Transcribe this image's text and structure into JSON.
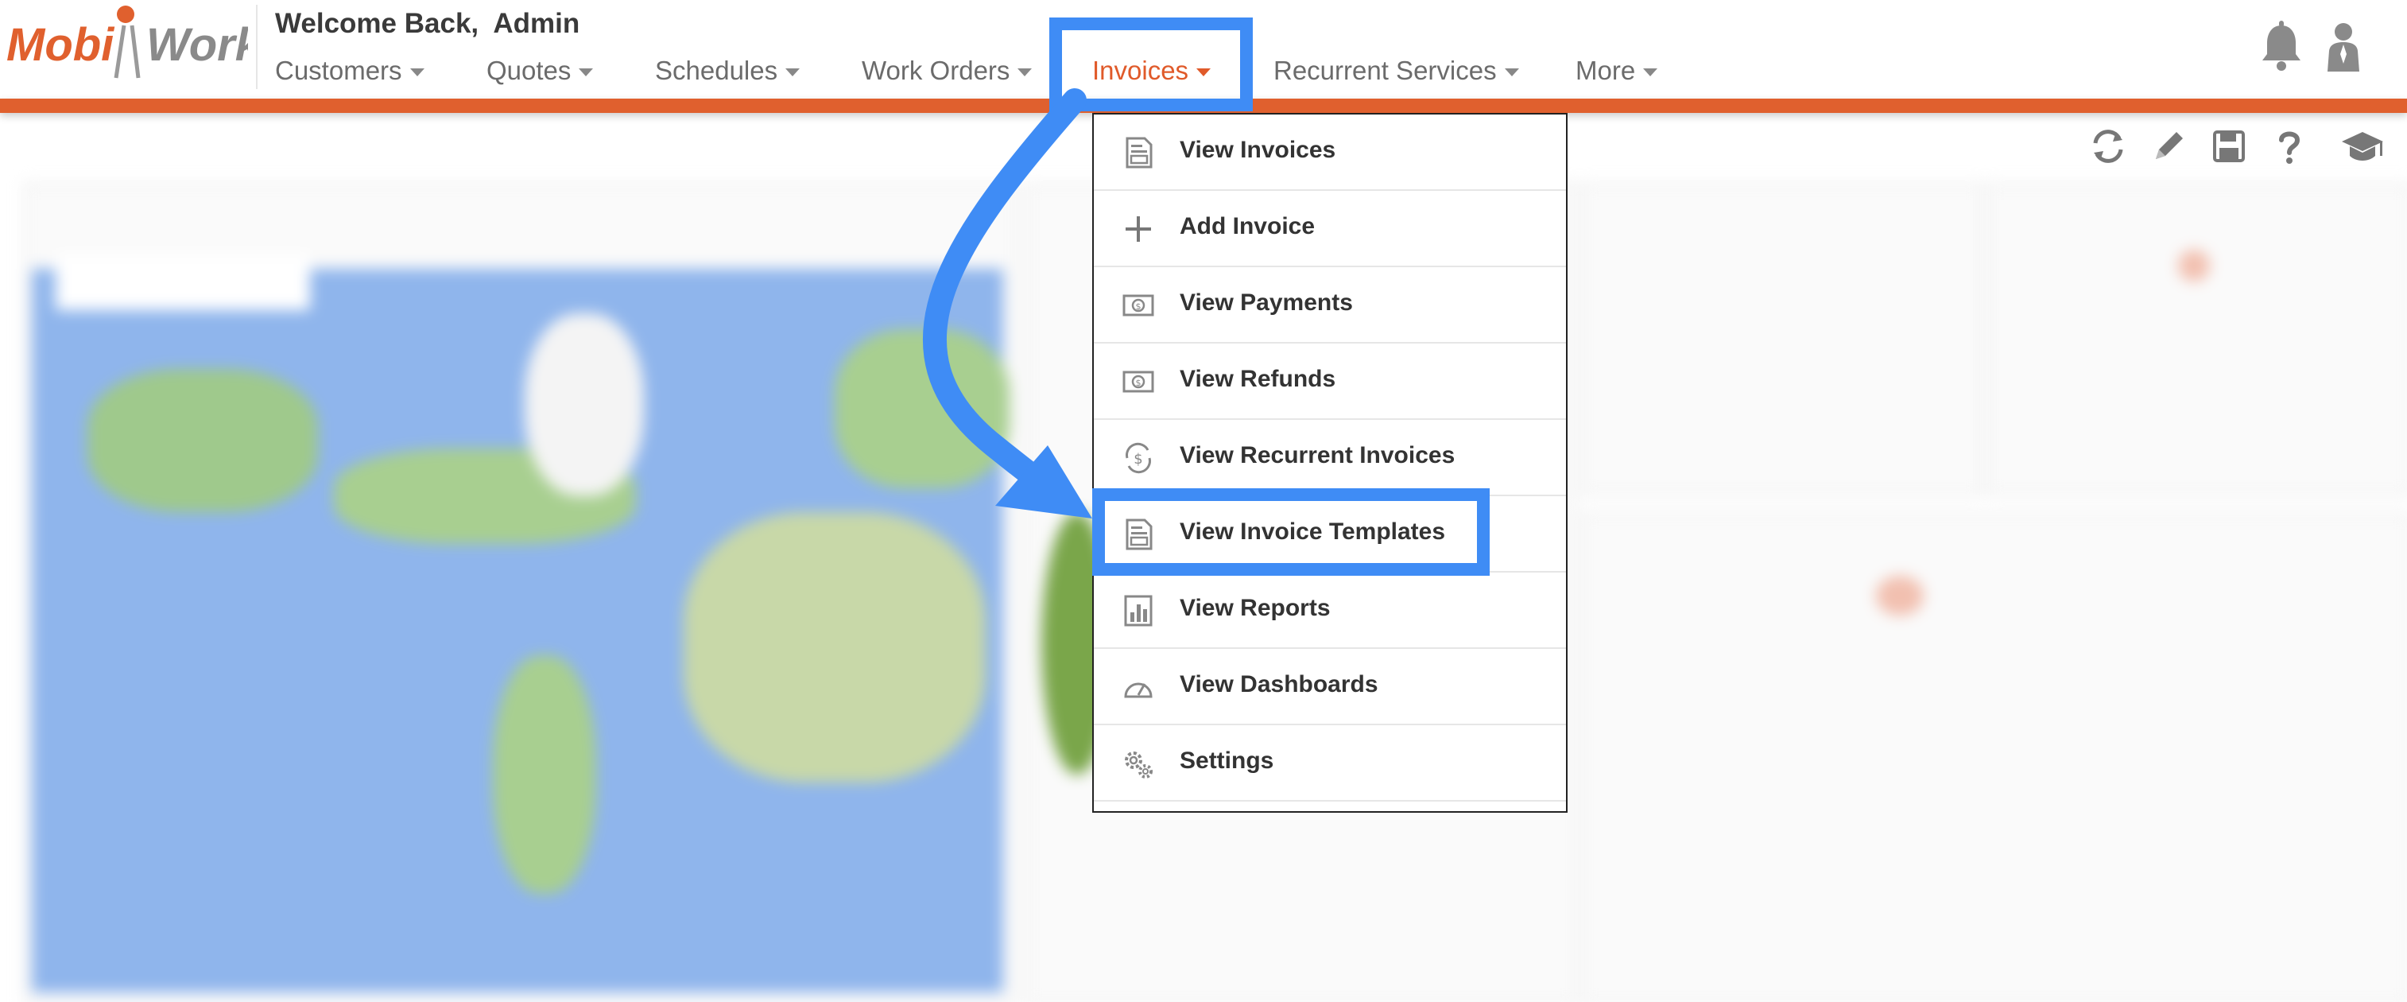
{
  "header": {
    "welcome_prefix": "Welcome Back,",
    "welcome_user": "Admin",
    "logo": {
      "part1": "Mobi",
      "part2": "Work"
    },
    "nav": [
      {
        "label": "Customers"
      },
      {
        "label": "Quotes"
      },
      {
        "label": "Schedules"
      },
      {
        "label": "Work Orders"
      },
      {
        "label": "Invoices",
        "active": true
      },
      {
        "label": "Recurrent Services"
      },
      {
        "label": "More"
      }
    ],
    "icons": [
      "bell-icon",
      "user-icon"
    ]
  },
  "toolbar": {
    "icons": [
      "refresh-icon",
      "pencil-icon",
      "save-icon",
      "help-icon",
      "graduation-cap-icon"
    ]
  },
  "dropdown": {
    "items": [
      {
        "label": "View Invoices",
        "icon": "invoice-document-icon"
      },
      {
        "label": "Add Invoice",
        "icon": "plus-icon"
      },
      {
        "label": "View Payments",
        "icon": "money-bill-icon"
      },
      {
        "label": "View Refunds",
        "icon": "money-bill-icon"
      },
      {
        "label": "View Recurrent Invoices",
        "icon": "recurring-dollar-icon"
      },
      {
        "label": "View Invoice Templates",
        "icon": "invoice-template-icon",
        "highlighted": true
      },
      {
        "label": "View Reports",
        "icon": "bar-chart-icon"
      },
      {
        "label": "View Dashboards",
        "icon": "speedometer-icon"
      },
      {
        "label": "Settings",
        "icon": "gears-icon"
      }
    ]
  },
  "colors": {
    "brand_orange": "#e0602e",
    "annotation_blue": "#3f8cf5",
    "nav_text": "#6b6b6b"
  }
}
